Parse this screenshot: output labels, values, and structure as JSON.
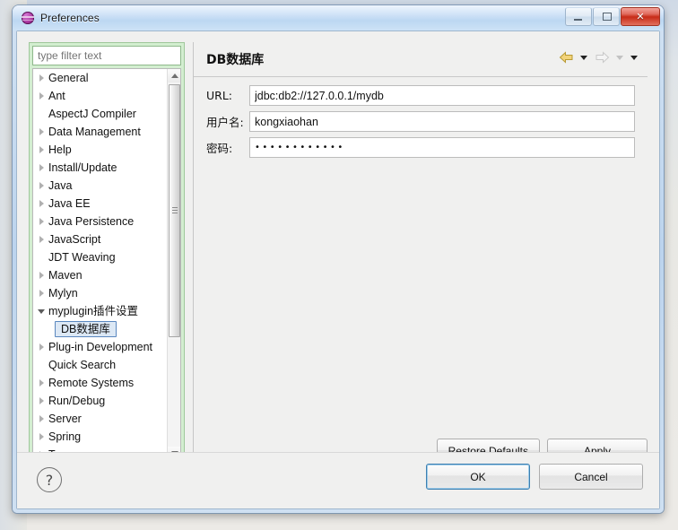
{
  "window": {
    "title": "Preferences",
    "icon": "preferences-globe-icon",
    "controls": {
      "minimize": "–",
      "maximize": "□",
      "close": "✕"
    }
  },
  "sidebar": {
    "filter": {
      "placeholder": "type filter text",
      "value": ""
    },
    "items": [
      {
        "label": "General",
        "twisty": "collapsed",
        "child": false,
        "selected": false
      },
      {
        "label": "Ant",
        "twisty": "collapsed",
        "child": false,
        "selected": false
      },
      {
        "label": "AspectJ Compiler",
        "twisty": "none",
        "child": false,
        "selected": false
      },
      {
        "label": "Data Management",
        "twisty": "collapsed",
        "child": false,
        "selected": false
      },
      {
        "label": "Help",
        "twisty": "collapsed",
        "child": false,
        "selected": false
      },
      {
        "label": "Install/Update",
        "twisty": "collapsed",
        "child": false,
        "selected": false
      },
      {
        "label": "Java",
        "twisty": "collapsed",
        "child": false,
        "selected": false
      },
      {
        "label": "Java EE",
        "twisty": "collapsed",
        "child": false,
        "selected": false
      },
      {
        "label": "Java Persistence",
        "twisty": "collapsed",
        "child": false,
        "selected": false
      },
      {
        "label": "JavaScript",
        "twisty": "collapsed",
        "child": false,
        "selected": false
      },
      {
        "label": "JDT Weaving",
        "twisty": "none",
        "child": false,
        "selected": false
      },
      {
        "label": "Maven",
        "twisty": "collapsed",
        "child": false,
        "selected": false
      },
      {
        "label": "Mylyn",
        "twisty": "collapsed",
        "child": false,
        "selected": false
      },
      {
        "label": "myplugin插件设置",
        "twisty": "expanded",
        "child": false,
        "selected": false
      },
      {
        "label": "DB数据库",
        "twisty": "none",
        "child": true,
        "selected": true
      },
      {
        "label": "Plug-in Development",
        "twisty": "collapsed",
        "child": false,
        "selected": false
      },
      {
        "label": "Quick Search",
        "twisty": "none",
        "child": false,
        "selected": false
      },
      {
        "label": "Remote Systems",
        "twisty": "collapsed",
        "child": false,
        "selected": false
      },
      {
        "label": "Run/Debug",
        "twisty": "collapsed",
        "child": false,
        "selected": false
      },
      {
        "label": "Server",
        "twisty": "collapsed",
        "child": false,
        "selected": false
      },
      {
        "label": "Spring",
        "twisty": "collapsed",
        "child": false,
        "selected": false
      },
      {
        "label": "Team",
        "twisty": "collapsed",
        "child": false,
        "selected": false
      }
    ]
  },
  "content": {
    "title": "DB数据库",
    "nav": {
      "back": "back-arrow-icon",
      "back_menu": "back-dropdown-icon",
      "forward": "forward-arrow-icon",
      "forward_menu": "forward-dropdown-icon",
      "view_menu": "view-menu-icon"
    },
    "fields": [
      {
        "label": "URL:",
        "value": "jdbc:db2://127.0.0.1/mydb",
        "type": "text",
        "name": "url"
      },
      {
        "label": "用户名:",
        "value": "kongxiaohan",
        "type": "text",
        "name": "username"
      },
      {
        "label": "密码:",
        "value": "••••••••••••",
        "type": "password",
        "name": "password"
      }
    ],
    "restore_defaults_label": "Restore Defaults",
    "apply_label": "Apply"
  },
  "footer": {
    "help_icon": "?",
    "ok_label": "OK",
    "cancel_label": "Cancel"
  },
  "colors": {
    "titlebar": "#bcd7f2",
    "tree_panel": "#d3eed0",
    "selection_border": "#5a87bf",
    "selection_fill": "#dce8f5",
    "default_button_border": "#3c7fb1",
    "close_button": "#c72b17"
  }
}
